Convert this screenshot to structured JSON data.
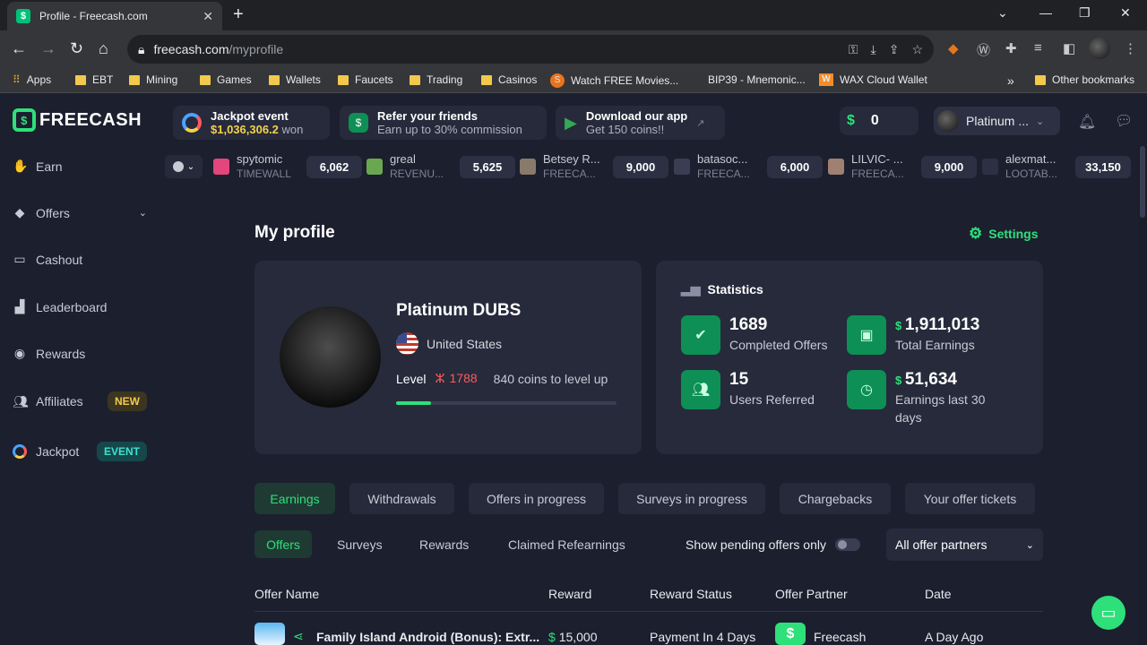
{
  "browser": {
    "tab_title": "Profile - Freecash.com",
    "url_host": "freecash.com",
    "url_path": "/myprofile",
    "bookmarks": [
      "Apps",
      "EBT",
      "Mining",
      "Games",
      "Wallets",
      "Faucets",
      "Trading",
      "Casinos",
      "Watch FREE Movies...",
      "BIP39 - Mnemonic...",
      "WAX Cloud Wallet"
    ],
    "overflow": "»",
    "other_bookmarks": "Other bookmarks"
  },
  "site": {
    "logo": "FREECASH",
    "nav": [
      {
        "label": "Earn",
        "icon": "hand-coin-icon"
      },
      {
        "label": "Offers",
        "icon": "tag-icon"
      },
      {
        "label": "Cashout",
        "icon": "wallet-icon"
      },
      {
        "label": "Leaderboard",
        "icon": "podium-icon"
      },
      {
        "label": "Rewards",
        "icon": "medal-icon"
      },
      {
        "label": "Affiliates",
        "icon": "users-icon",
        "badge": "NEW"
      },
      {
        "label": "Jackpot",
        "icon": "ring-icon",
        "badge": "EVENT"
      }
    ]
  },
  "topbar": {
    "jackpot_title": "Jackpot event",
    "jackpot_amount": "$1,036,306.2",
    "jackpot_suffix": "won",
    "refer_title": "Refer your friends",
    "refer_sub": "Earn up to 30% commission",
    "app_title": "Download our app",
    "app_sub": "Get 150 coins!!",
    "coins": "0",
    "username": "Platinum ..."
  },
  "live": [
    {
      "name": "spytomic",
      "src": "TIMEWALL",
      "amount": "6,062",
      "color": "#e2467a"
    },
    {
      "name": "greal",
      "src": "REVENU...",
      "amount": "5,625",
      "color": "#6aa84f"
    },
    {
      "name": "Betsey R...",
      "src": "FREECA...",
      "amount": "9,000",
      "color": "#8a7a6a"
    },
    {
      "name": "batasoc...",
      "src": "FREECA...",
      "amount": "6,000",
      "color": "#3a3e52"
    },
    {
      "name": "LILVIC- ...",
      "src": "FREECA...",
      "amount": "9,000",
      "color": "#a08070"
    },
    {
      "name": "alexmat...",
      "src": "LOOTAB...",
      "amount": "33,150",
      "color": "#2c3042"
    }
  ],
  "profile": {
    "page_title": "My profile",
    "settings": "Settings",
    "name": "Platinum DUBS",
    "country": "United States",
    "level_label": "Level",
    "level": "1788",
    "to_next": "840 coins to level up",
    "progress": 0.16
  },
  "stats": {
    "title": "Statistics",
    "items": [
      {
        "value": "1689",
        "label": "Completed Offers",
        "coin": false
      },
      {
        "value": "1,911,013",
        "label": "Total Earnings",
        "coin": true
      },
      {
        "value": "15",
        "label": "Users Referred",
        "coin": false
      },
      {
        "value": "51,634",
        "label": "Earnings last 30 days",
        "coin": true
      }
    ]
  },
  "tabs": [
    "Earnings",
    "Withdrawals",
    "Offers in progress",
    "Surveys in progress",
    "Chargebacks",
    "Your offer tickets"
  ],
  "subtabs": [
    "Offers",
    "Surveys",
    "Rewards",
    "Claimed Refearnings"
  ],
  "filter": {
    "pending_label": "Show pending offers only",
    "partner_select": "All offer partners"
  },
  "table": {
    "headers": [
      "Offer Name",
      "Reward",
      "Reward Status",
      "Offer Partner",
      "Date"
    ],
    "rows": [
      {
        "name": "Family Island Android (Bonus): Extr...",
        "reward": "15,000",
        "status": "Payment In 4 Days",
        "partner": "Freecash",
        "date": "A Day Ago"
      }
    ]
  },
  "colors": {
    "accent": "#2ee07a",
    "bg": "#1c1f2e",
    "card": "#262a3b",
    "jackpot_yellow": "#f5d14a",
    "level_red": "#ff5a5a"
  }
}
